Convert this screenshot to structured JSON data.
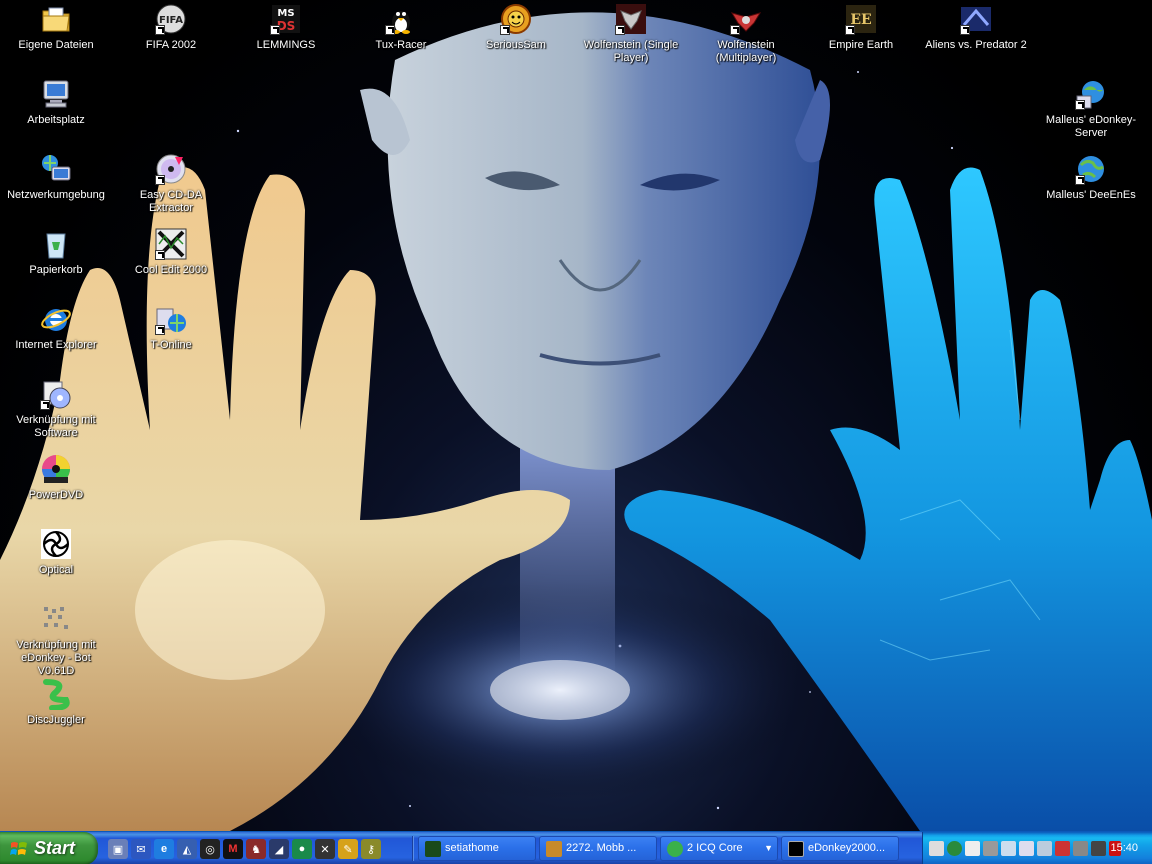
{
  "desktop": {
    "icons": [
      {
        "label": "Eigene Dateien",
        "icon": "my-documents-icon",
        "shortcut": false
      },
      {
        "label": "FIFA 2002",
        "icon": "fifa-icon",
        "shortcut": true
      },
      {
        "label": "LEMMINGS",
        "icon": "lemmings-icon",
        "shortcut": true
      },
      {
        "label": "Tux-Racer",
        "icon": "tux-icon",
        "shortcut": true
      },
      {
        "label": "SeriousSam",
        "icon": "serious-sam-icon",
        "shortcut": true
      },
      {
        "label": "Wolfenstein (Single Player)",
        "icon": "wolfenstein-sp-icon",
        "shortcut": true
      },
      {
        "label": "Wolfenstein (Multiplayer)",
        "icon": "wolfenstein-mp-icon",
        "shortcut": true
      },
      {
        "label": "Empire Earth",
        "icon": "empire-earth-icon",
        "shortcut": true
      },
      {
        "label": "Aliens vs. Predator 2",
        "icon": "avp2-icon",
        "shortcut": true
      },
      {
        "label": "Arbeitsplatz",
        "icon": "my-computer-icon",
        "shortcut": false
      },
      {
        "label": "Netzwerkumgebung",
        "icon": "network-icon",
        "shortcut": false
      },
      {
        "label": "Easy CD-DA Extractor",
        "icon": "cd-extractor-icon",
        "shortcut": true
      },
      {
        "label": "Papierkorb",
        "icon": "recycle-bin-icon",
        "shortcut": false
      },
      {
        "label": "Cool Edit 2000",
        "icon": "cool-edit-icon",
        "shortcut": true
      },
      {
        "label": "Internet Explorer",
        "icon": "internet-explorer-icon",
        "shortcut": false
      },
      {
        "label": "T-Online",
        "icon": "t-online-icon",
        "shortcut": true
      },
      {
        "label": "Verknüpfung mit Software",
        "icon": "software-shortcut-icon",
        "shortcut": true
      },
      {
        "label": "PowerDVD",
        "icon": "powerdvd-icon",
        "shortcut": false
      },
      {
        "label": "Optical",
        "icon": "optical-icon",
        "shortcut": false
      },
      {
        "label": "Verknüpfung mit eDonkey - Bot V0.61D",
        "icon": "edonkey-bot-icon",
        "shortcut": false
      },
      {
        "label": "DiscJuggler",
        "icon": "discjuggler-icon",
        "shortcut": false
      },
      {
        "label": "Malleus' eDonkey-Server",
        "icon": "edonkey-server-icon",
        "shortcut": true
      },
      {
        "label": "Malleus' DeeEnEs",
        "icon": "dns-globe-icon",
        "shortcut": true
      }
    ]
  },
  "taskbar": {
    "start_label": "Start",
    "quick_launch": [
      "show-desktop-icon",
      "outlook-icon",
      "ie-quick-icon",
      "media-icon",
      "target-icon",
      "gmail-m-icon",
      "game-icon",
      "chart-icon",
      "globe-icon",
      "tools-icon",
      "pen-icon",
      "key-icon"
    ],
    "buttons": [
      {
        "label": "setiathome",
        "icon": "seti-icon"
      },
      {
        "label": "2272. Mobb ...",
        "icon": "music-icon"
      },
      {
        "label": "2 ICQ Core",
        "icon": "icq-flower-icon"
      },
      {
        "label": "eDonkey2000...",
        "icon": "console-icon"
      }
    ],
    "tray_icons": [
      "jet-icon",
      "network-tray-icon",
      "monster-icon",
      "usb-icon",
      "volume-icon",
      "monitor-icon",
      "network-tray-2-icon",
      "flag-icon",
      "shield-tray-icon",
      "speaker-icon",
      "ati-icon"
    ],
    "clock": "15:40"
  },
  "colors": {
    "taskbar_blue": "#2663e0",
    "start_green": "#3d953d",
    "tray_blue": "#12a0e8"
  }
}
